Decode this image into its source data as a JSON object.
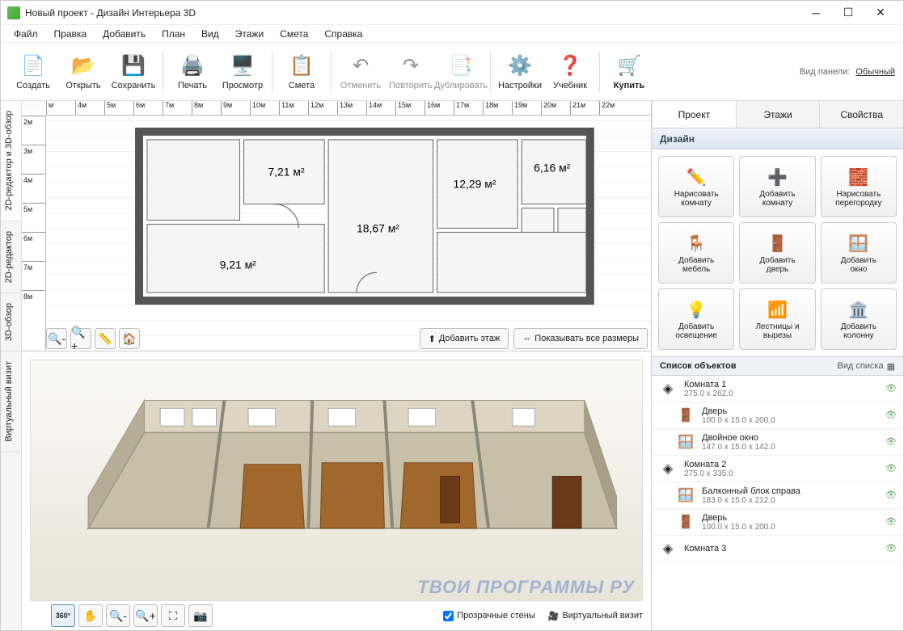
{
  "title": "Новый проект - Дизайн Интерьера 3D",
  "menu": [
    "Файл",
    "Правка",
    "Добавить",
    "План",
    "Вид",
    "Этажи",
    "Смета",
    "Справка"
  ],
  "toolbar": {
    "create": "Создать",
    "open": "Открыть",
    "save": "Сохранить",
    "print": "Печать",
    "preview": "Просмотр",
    "estimate": "Смета",
    "undo": "Отменить",
    "redo": "Повторить",
    "duplicate": "Дублировать",
    "settings": "Настройки",
    "tutorial": "Учебник",
    "buy": "Купить",
    "panel_label": "Вид панели:",
    "panel_mode": "Обычный"
  },
  "side_tabs": [
    "2D-редактор и 3D-обзор",
    "2D-редактор",
    "3D-обзор",
    "Виртуальный визит"
  ],
  "ruler_h": [
    "м",
    "4м",
    "5м",
    "6м",
    "7м",
    "8м",
    "9м",
    "10м",
    "11м",
    "12м",
    "13м",
    "14м",
    "15м",
    "16м",
    "17м",
    "18м",
    "19м",
    "20м",
    "21м",
    "22м"
  ],
  "ruler_v": [
    "2м",
    "3м",
    "4м",
    "5м",
    "6м",
    "7м",
    "8м"
  ],
  "rooms": {
    "r1": "7,21 м²",
    "r2": "18,67 м²",
    "r3": "12,29 м²",
    "r4": "6,16 м²",
    "r5": "9,21 м²"
  },
  "plan_actions": {
    "add_floor": "Добавить этаж",
    "show_dims": "Показывать все размеры"
  },
  "render_controls": {
    "transparent": "Прозрачные стены",
    "video": "Виртуальный визит"
  },
  "rp_tabs": [
    "Проект",
    "Этажи",
    "Свойства"
  ],
  "rp_section": "Дизайн",
  "tools": [
    {
      "l1": "Нарисовать",
      "l2": "комнату",
      "icon": "✏️"
    },
    {
      "l1": "Добавить",
      "l2": "комнату",
      "icon": "➕"
    },
    {
      "l1": "Нарисовать",
      "l2": "перегородку",
      "icon": "🧱"
    },
    {
      "l1": "Добавить",
      "l2": "мебель",
      "icon": "🪑"
    },
    {
      "l1": "Добавить",
      "l2": "дверь",
      "icon": "🚪"
    },
    {
      "l1": "Добавить",
      "l2": "окно",
      "icon": "🪟"
    },
    {
      "l1": "Добавить",
      "l2": "освещение",
      "icon": "💡"
    },
    {
      "l1": "Лестницы и",
      "l2": "вырезы",
      "icon": "📶"
    },
    {
      "l1": "Добавить",
      "l2": "колонну",
      "icon": "🏛️"
    }
  ],
  "objects_header": "Список объектов",
  "view_list": "Вид списка",
  "objects": [
    {
      "name": "Комната 1",
      "dims": "275.0 x 262.0",
      "icon": "◈",
      "child": false
    },
    {
      "name": "Дверь",
      "dims": "100.0 x 15.0 x 200.0",
      "icon": "🚪",
      "child": true
    },
    {
      "name": "Двойное окно",
      "dims": "147.0 x 15.0 x 142.0",
      "icon": "🪟",
      "child": true
    },
    {
      "name": "Комната 2",
      "dims": "275.0 x 335.0",
      "icon": "◈",
      "child": false
    },
    {
      "name": "Балконный блок справа",
      "dims": "183.0 x 15.0 x 212.0",
      "icon": "🪟",
      "child": true
    },
    {
      "name": "Дверь",
      "dims": "100.0 x 15.0 x 200.0",
      "icon": "🚪",
      "child": true
    },
    {
      "name": "Комната 3",
      "dims": "",
      "icon": "◈",
      "child": false
    }
  ],
  "watermark": "ТВОИ ПРОГРАММЫ РУ"
}
